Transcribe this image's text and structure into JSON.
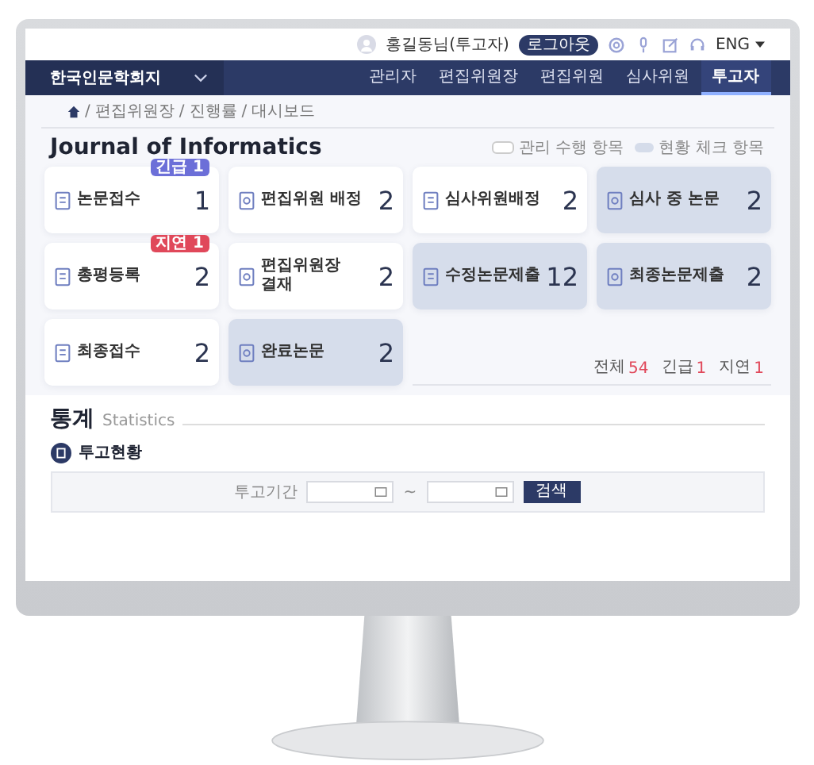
{
  "topbar": {
    "user": "홍길동님(투고자)",
    "logout": "로그아웃",
    "language": "ENG"
  },
  "nav": {
    "journal": "한국인문학회지",
    "items": [
      {
        "label": "관리자",
        "selected": false
      },
      {
        "label": "편집위원장",
        "selected": false
      },
      {
        "label": "편집위원",
        "selected": false
      },
      {
        "label": "심사위원",
        "selected": false
      },
      {
        "label": "투고자",
        "selected": true
      }
    ]
  },
  "breadcrumb": [
    "편집위원장",
    "진행률",
    "대시보드"
  ],
  "breadcrumb_separator": "/",
  "dashboard": {
    "title": "Journal of Informatics",
    "legend": [
      {
        "kind": "manage",
        "label": "관리 수행 항목"
      },
      {
        "kind": "check",
        "label": "현황 체크 항목"
      }
    ],
    "cards": [
      {
        "kind": "manage",
        "label": "논문접수",
        "count": "1",
        "badge": {
          "text": "긴급 1",
          "color": "#6c6fd8"
        }
      },
      {
        "kind": "manage",
        "label": "편집위원 배정",
        "count": "2"
      },
      {
        "kind": "manage",
        "label": "심사위원배정",
        "count": "2"
      },
      {
        "kind": "check",
        "label": "심사 중 논문",
        "count": "2"
      },
      {
        "kind": "manage",
        "label": "총평등록",
        "count": "2",
        "badge": {
          "text": "지연 1",
          "color": "#e0485a"
        }
      },
      {
        "kind": "manage",
        "label": "편집위원장 결재",
        "count": "2"
      },
      {
        "kind": "check",
        "label": "수정논문제출",
        "count": "12"
      },
      {
        "kind": "check",
        "label": "최종논문제출",
        "count": "2"
      },
      {
        "kind": "manage",
        "label": "최종접수",
        "count": "2"
      },
      {
        "kind": "check",
        "label": "완료논문",
        "count": "2"
      }
    ],
    "totals": [
      {
        "label": "전체",
        "value": "54"
      },
      {
        "label": "긴급",
        "value": "1"
      },
      {
        "label": "지연",
        "value": "1"
      }
    ]
  },
  "statistics": {
    "title": "통계",
    "subtitle": "Statistics",
    "section": "투고현황",
    "period_label": "투고기간",
    "separator": "~",
    "search": "검색"
  }
}
